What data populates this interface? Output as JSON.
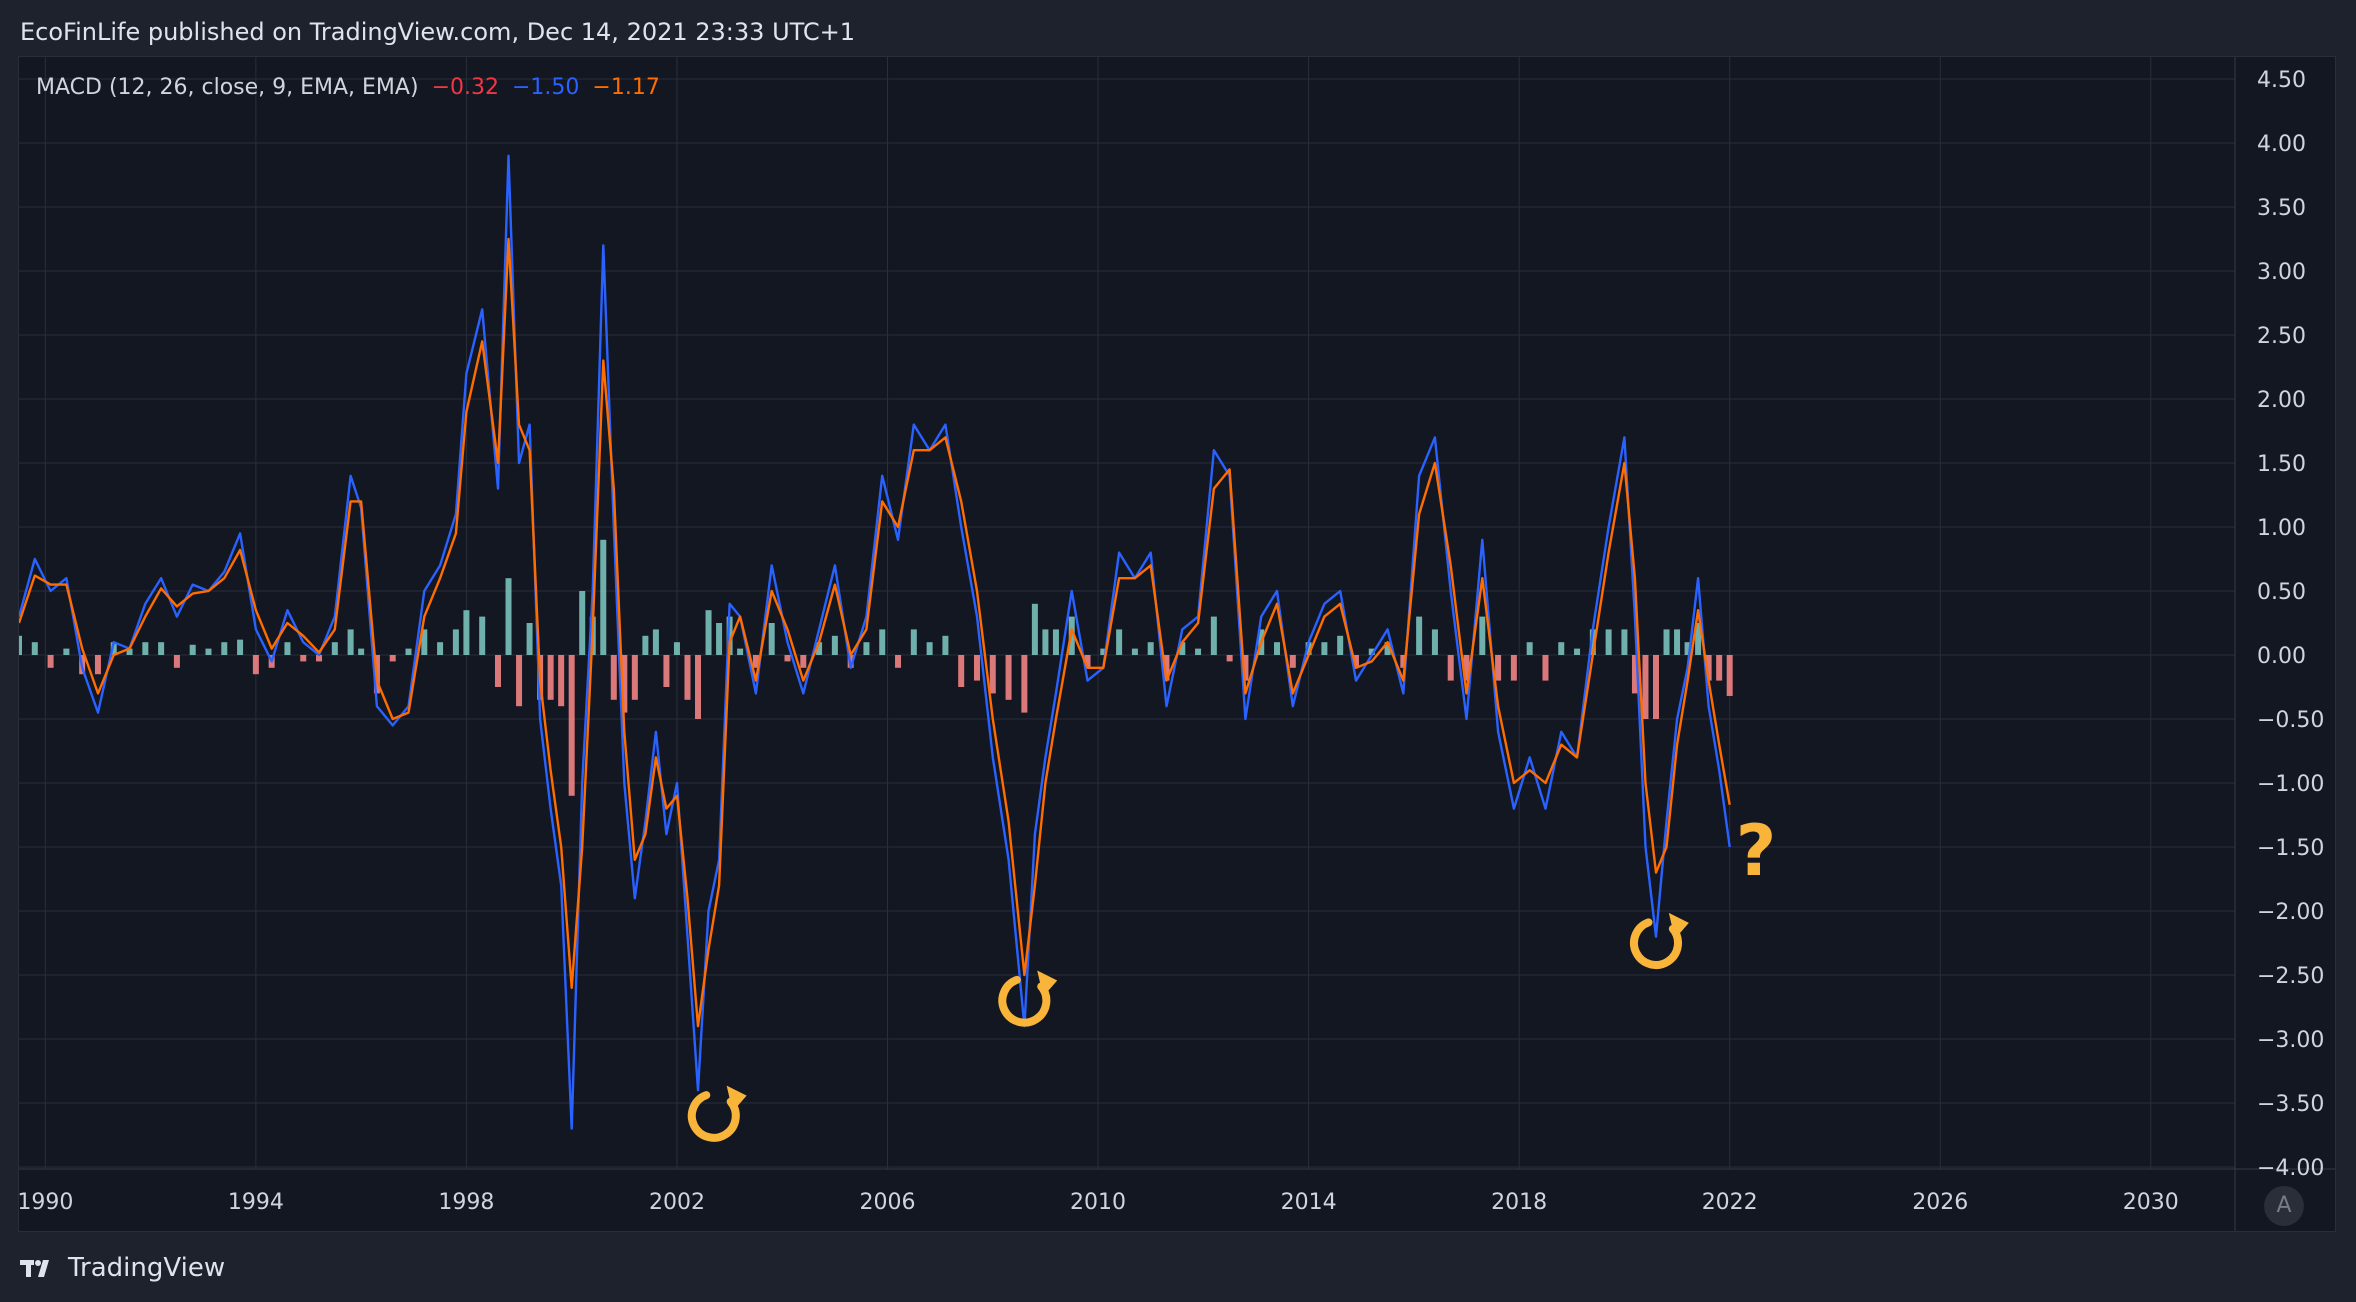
{
  "header": {
    "publisher_line": "EcoFinLife published on TradingView.com, Dec 14, 2021 23:33 UTC+1"
  },
  "legend": {
    "indicator": "MACD (12, 26, close, 9, EMA, EMA)",
    "histogram_value": "−0.32",
    "macd_value": "−1.50",
    "signal_value": "−1.17"
  },
  "footer": {
    "brand": "TradingView"
  },
  "controls": {
    "auto_scale_label": "A"
  },
  "annotations": {
    "question_mark": "?"
  },
  "colors": {
    "background": "#131722",
    "page": "#1e222d",
    "grid": "#2a2e39",
    "macd_line": "#2962ff",
    "signal_line": "#ff6d00",
    "hist_positive": "#80cbc4",
    "hist_negative": "#ff8a8a",
    "annotation": "#f9b43a",
    "legend_hist": "#f23645",
    "legend_macd": "#2962ff",
    "legend_signal": "#ff6d00"
  },
  "chart_data": {
    "type": "line",
    "indicator": "MACD (12, 26, close, 9, EMA, EMA)",
    "x_range": [
      1989.5,
      2031.6
    ],
    "ylim": [
      -4.0,
      4.7
    ],
    "x_ticks": [
      1990,
      1994,
      1998,
      2002,
      2006,
      2010,
      2014,
      2018,
      2022,
      2026,
      2030
    ],
    "x_tick_labels": [
      "1990",
      "1994",
      "1998",
      "2002",
      "2006",
      "2010",
      "2014",
      "2018",
      "2022",
      "2026",
      "2030"
    ],
    "y_ticks": [
      4.5,
      4.0,
      3.5,
      3.0,
      2.5,
      2.0,
      1.5,
      1.0,
      0.5,
      0.0,
      -0.5,
      -1.0,
      -1.5,
      -2.0,
      -2.5,
      -3.0,
      -3.5,
      -4.0
    ],
    "y_tick_labels": [
      "4.50",
      "4.00",
      "3.50",
      "3.00",
      "2.50",
      "2.00",
      "1.50",
      "1.00",
      "0.50",
      "0.00",
      "−0.50",
      "−1.00",
      "−1.50",
      "−2.00",
      "−2.50",
      "−3.00",
      "−3.50",
      "−4.00"
    ],
    "grid": true,
    "series": [
      {
        "name": "MACD",
        "style": "line",
        "color": "#2962ff",
        "x": [
          1989.5,
          1989.8,
          1990.1,
          1990.4,
          1990.7,
          1991.0,
          1991.3,
          1991.6,
          1991.9,
          1992.2,
          1992.5,
          1992.8,
          1993.1,
          1993.4,
          1993.7,
          1994.0,
          1994.3,
          1994.6,
          1994.9,
          1995.2,
          1995.5,
          1995.8,
          1996.0,
          1996.3,
          1996.6,
          1996.9,
          1997.2,
          1997.5,
          1997.8,
          1998.0,
          1998.3,
          1998.6,
          1998.8,
          1999.0,
          1999.2,
          1999.4,
          1999.6,
          1999.8,
          2000.0,
          2000.2,
          2000.4,
          2000.6,
          2000.8,
          2001.0,
          2001.2,
          2001.4,
          2001.6,
          2001.8,
          2002.0,
          2002.2,
          2002.4,
          2002.6,
          2002.8,
          2003.0,
          2003.2,
          2003.5,
          2003.8,
          2004.1,
          2004.4,
          2004.7,
          2005.0,
          2005.3,
          2005.6,
          2005.9,
          2006.2,
          2006.5,
          2006.8,
          2007.1,
          2007.4,
          2007.7,
          2008.0,
          2008.3,
          2008.6,
          2008.8,
          2009.0,
          2009.2,
          2009.5,
          2009.8,
          2010.1,
          2010.4,
          2010.7,
          2011.0,
          2011.3,
          2011.6,
          2011.9,
          2012.2,
          2012.5,
          2012.8,
          2013.1,
          2013.4,
          2013.7,
          2014.0,
          2014.3,
          2014.6,
          2014.9,
          2015.2,
          2015.5,
          2015.8,
          2016.1,
          2016.4,
          2016.7,
          2017.0,
          2017.3,
          2017.6,
          2017.9,
          2018.2,
          2018.5,
          2018.8,
          2019.1,
          2019.4,
          2019.7,
          2020.0,
          2020.2,
          2020.4,
          2020.6,
          2020.8,
          2021.0,
          2021.2,
          2021.4,
          2021.6,
          2021.8,
          2022.0
        ],
        "values": [
          0.3,
          0.75,
          0.5,
          0.6,
          -0.1,
          -0.45,
          0.1,
          0.05,
          0.4,
          0.6,
          0.3,
          0.55,
          0.5,
          0.65,
          0.95,
          0.2,
          -0.05,
          0.35,
          0.1,
          0.0,
          0.3,
          1.4,
          1.15,
          -0.4,
          -0.55,
          -0.4,
          0.5,
          0.7,
          1.1,
          2.2,
          2.7,
          1.3,
          3.9,
          1.5,
          1.8,
          -0.5,
          -1.2,
          -1.8,
          -3.7,
          -1.0,
          0.5,
          3.2,
          1.0,
          -1.0,
          -1.9,
          -1.3,
          -0.6,
          -1.4,
          -1.0,
          -2.2,
          -3.4,
          -2.0,
          -1.6,
          0.4,
          0.3,
          -0.3,
          0.7,
          0.1,
          -0.3,
          0.2,
          0.7,
          -0.1,
          0.3,
          1.4,
          0.9,
          1.8,
          1.6,
          1.8,
          1.0,
          0.3,
          -0.8,
          -1.6,
          -2.9,
          -1.4,
          -0.8,
          -0.3,
          0.5,
          -0.2,
          -0.1,
          0.8,
          0.6,
          0.8,
          -0.4,
          0.2,
          0.3,
          1.6,
          1.4,
          -0.5,
          0.3,
          0.5,
          -0.4,
          0.1,
          0.4,
          0.5,
          -0.2,
          0.0,
          0.2,
          -0.3,
          1.4,
          1.7,
          0.5,
          -0.5,
          0.9,
          -0.6,
          -1.2,
          -0.8,
          -1.2,
          -0.6,
          -0.8,
          0.2,
          1.0,
          1.7,
          0.3,
          -1.5,
          -2.2,
          -1.3,
          -0.5,
          -0.1,
          0.6,
          -0.4,
          -0.9,
          -1.5
        ]
      },
      {
        "name": "Signal",
        "style": "line",
        "color": "#ff6d00",
        "x": [
          1989.5,
          1989.8,
          1990.1,
          1990.4,
          1990.7,
          1991.0,
          1991.3,
          1991.6,
          1991.9,
          1992.2,
          1992.5,
          1992.8,
          1993.1,
          1993.4,
          1993.7,
          1994.0,
          1994.3,
          1994.6,
          1994.9,
          1995.2,
          1995.5,
          1995.8,
          1996.0,
          1996.3,
          1996.6,
          1996.9,
          1997.2,
          1997.5,
          1997.8,
          1998.0,
          1998.3,
          1998.6,
          1998.8,
          1999.0,
          1999.2,
          1999.4,
          1999.6,
          1999.8,
          2000.0,
          2000.2,
          2000.4,
          2000.6,
          2000.8,
          2001.0,
          2001.2,
          2001.4,
          2001.6,
          2001.8,
          2002.0,
          2002.2,
          2002.4,
          2002.6,
          2002.8,
          2003.0,
          2003.2,
          2003.5,
          2003.8,
          2004.1,
          2004.4,
          2004.7,
          2005.0,
          2005.3,
          2005.6,
          2005.9,
          2006.2,
          2006.5,
          2006.8,
          2007.1,
          2007.4,
          2007.7,
          2008.0,
          2008.3,
          2008.6,
          2008.8,
          2009.0,
          2009.2,
          2009.5,
          2009.8,
          2010.1,
          2010.4,
          2010.7,
          2011.0,
          2011.3,
          2011.6,
          2011.9,
          2012.2,
          2012.5,
          2012.8,
          2013.1,
          2013.4,
          2013.7,
          2014.0,
          2014.3,
          2014.6,
          2014.9,
          2015.2,
          2015.5,
          2015.8,
          2016.1,
          2016.4,
          2016.7,
          2017.0,
          2017.3,
          2017.6,
          2017.9,
          2018.2,
          2018.5,
          2018.8,
          2019.1,
          2019.4,
          2019.7,
          2020.0,
          2020.2,
          2020.4,
          2020.6,
          2020.8,
          2021.0,
          2021.2,
          2021.4,
          2021.6,
          2021.8,
          2022.0
        ],
        "values": [
          0.25,
          0.62,
          0.55,
          0.55,
          0.05,
          -0.3,
          0.0,
          0.05,
          0.3,
          0.52,
          0.38,
          0.48,
          0.5,
          0.6,
          0.82,
          0.35,
          0.05,
          0.25,
          0.15,
          0.02,
          0.2,
          1.2,
          1.2,
          -0.2,
          -0.5,
          -0.45,
          0.3,
          0.6,
          0.95,
          1.9,
          2.45,
          1.5,
          3.25,
          1.8,
          1.6,
          -0.2,
          -0.9,
          -1.5,
          -2.6,
          -1.5,
          0.2,
          2.3,
          1.3,
          -0.6,
          -1.6,
          -1.4,
          -0.8,
          -1.2,
          -1.1,
          -1.9,
          -2.9,
          -2.3,
          -1.8,
          0.1,
          0.3,
          -0.2,
          0.5,
          0.2,
          -0.2,
          0.1,
          0.55,
          0.0,
          0.2,
          1.2,
          1.0,
          1.6,
          1.6,
          1.7,
          1.2,
          0.5,
          -0.5,
          -1.3,
          -2.5,
          -1.8,
          -1.0,
          -0.5,
          0.2,
          -0.1,
          -0.1,
          0.6,
          0.6,
          0.7,
          -0.2,
          0.1,
          0.25,
          1.3,
          1.45,
          -0.3,
          0.1,
          0.4,
          -0.3,
          0.0,
          0.3,
          0.4,
          -0.1,
          -0.05,
          0.1,
          -0.2,
          1.1,
          1.5,
          0.7,
          -0.3,
          0.6,
          -0.4,
          -1.0,
          -0.9,
          -1.0,
          -0.7,
          -0.8,
          0.0,
          0.8,
          1.5,
          0.6,
          -1.0,
          -1.7,
          -1.5,
          -0.7,
          -0.2,
          0.35,
          -0.2,
          -0.7,
          -1.17
        ]
      },
      {
        "name": "Histogram",
        "style": "histogram",
        "x": [
          1989.5,
          1989.8,
          1990.1,
          1990.4,
          1990.7,
          1991.0,
          1991.3,
          1991.6,
          1991.9,
          1992.2,
          1992.5,
          1992.8,
          1993.1,
          1993.4,
          1993.7,
          1994.0,
          1994.3,
          1994.6,
          1994.9,
          1995.2,
          1995.5,
          1995.8,
          1996.0,
          1996.3,
          1996.6,
          1996.9,
          1997.2,
          1997.5,
          1997.8,
          1998.0,
          1998.3,
          1998.6,
          1998.8,
          1999.0,
          1999.2,
          1999.4,
          1999.6,
          1999.8,
          2000.0,
          2000.2,
          2000.4,
          2000.6,
          2000.8,
          2001.0,
          2001.2,
          2001.4,
          2001.6,
          2001.8,
          2002.0,
          2002.2,
          2002.4,
          2002.6,
          2002.8,
          2003.0,
          2003.2,
          2003.5,
          2003.8,
          2004.1,
          2004.4,
          2004.7,
          2005.0,
          2005.3,
          2005.6,
          2005.9,
          2006.2,
          2006.5,
          2006.8,
          2007.1,
          2007.4,
          2007.7,
          2008.0,
          2008.3,
          2008.6,
          2008.8,
          2009.0,
          2009.2,
          2009.5,
          2009.8,
          2010.1,
          2010.4,
          2010.7,
          2011.0,
          2011.3,
          2011.6,
          2011.9,
          2012.2,
          2012.5,
          2012.8,
          2013.1,
          2013.4,
          2013.7,
          2014.0,
          2014.3,
          2014.6,
          2014.9,
          2015.2,
          2015.5,
          2015.8,
          2016.1,
          2016.4,
          2016.7,
          2017.0,
          2017.3,
          2017.6,
          2017.9,
          2018.2,
          2018.5,
          2018.8,
          2019.1,
          2019.4,
          2019.7,
          2020.0,
          2020.2,
          2020.4,
          2020.6,
          2020.8,
          2021.0,
          2021.2,
          2021.4,
          2021.6,
          2021.8,
          2022.0
        ],
        "values": [
          0.15,
          0.1,
          -0.1,
          0.05,
          -0.15,
          -0.15,
          0.1,
          0.05,
          0.1,
          0.1,
          -0.1,
          0.08,
          0.05,
          0.1,
          0.12,
          -0.15,
          -0.1,
          0.1,
          -0.05,
          -0.05,
          0.1,
          0.2,
          0.05,
          -0.3,
          -0.05,
          0.05,
          0.2,
          0.1,
          0.2,
          0.35,
          0.3,
          -0.25,
          0.6,
          -0.4,
          0.25,
          -0.35,
          -0.35,
          -0.4,
          -1.1,
          0.5,
          0.3,
          0.9,
          -0.35,
          -0.45,
          -0.35,
          0.15,
          0.2,
          -0.25,
          0.1,
          -0.35,
          -0.5,
          0.35,
          0.25,
          0.3,
          0.05,
          -0.1,
          0.25,
          -0.05,
          -0.1,
          0.1,
          0.15,
          -0.1,
          0.1,
          0.2,
          -0.1,
          0.2,
          0.1,
          0.15,
          -0.25,
          -0.2,
          -0.3,
          -0.35,
          -0.45,
          0.4,
          0.2,
          0.2,
          0.3,
          -0.1,
          0.05,
          0.2,
          0.05,
          0.1,
          -0.2,
          0.1,
          0.05,
          0.3,
          -0.05,
          -0.2,
          0.2,
          0.1,
          -0.1,
          0.1,
          0.1,
          0.15,
          -0.1,
          0.05,
          0.1,
          -0.1,
          0.3,
          0.2,
          -0.2,
          -0.2,
          0.3,
          -0.2,
          -0.2,
          0.1,
          -0.2,
          0.1,
          0.05,
          0.2,
          0.2,
          0.2,
          -0.3,
          -0.5,
          -0.5,
          0.2,
          0.2,
          0.1,
          0.25,
          -0.2,
          -0.2,
          -0.32
        ]
      }
    ],
    "annotations": [
      {
        "type": "circular-arrow-icon",
        "x": 2002.7,
        "y": -3.6
      },
      {
        "type": "circular-arrow-icon",
        "x": 2008.6,
        "y": -2.7
      },
      {
        "type": "circular-arrow-icon",
        "x": 2020.6,
        "y": -2.25
      },
      {
        "type": "question-mark",
        "text": "?",
        "x": 2022.5,
        "y": -1.5
      }
    ]
  }
}
